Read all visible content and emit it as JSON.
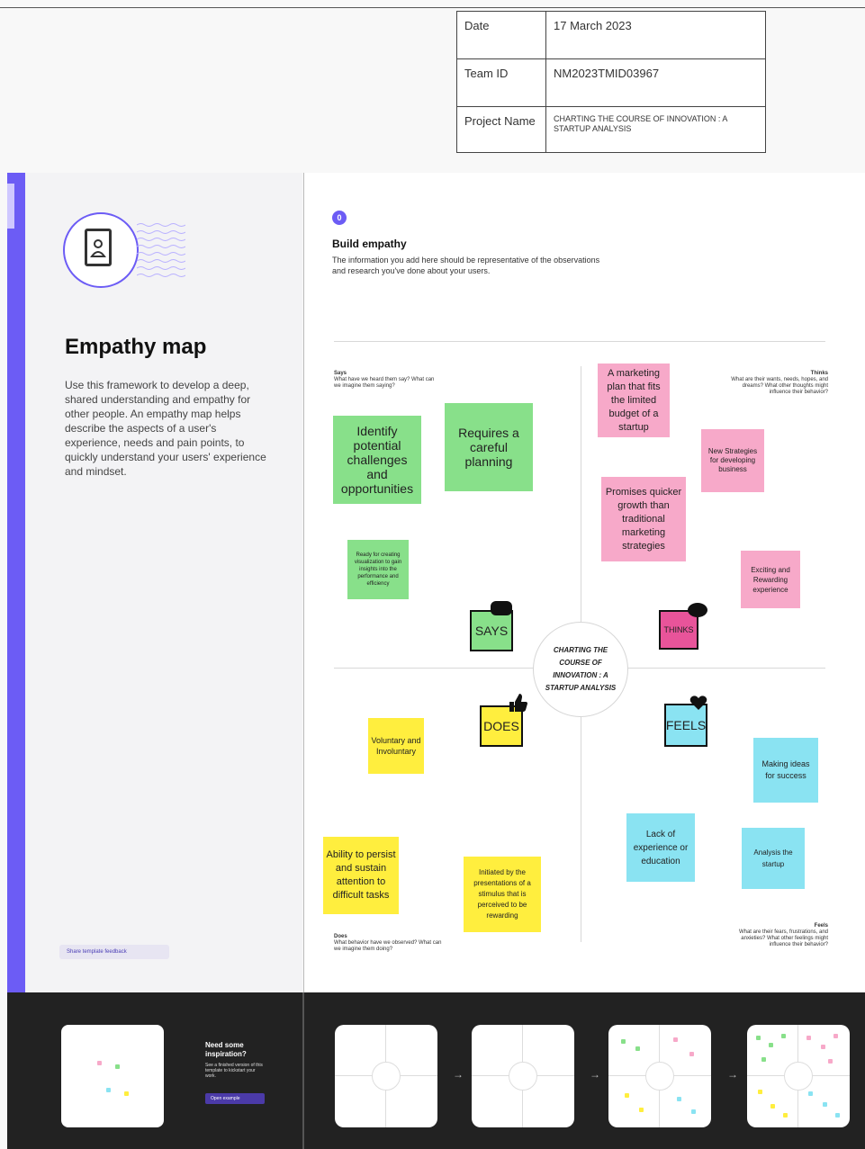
{
  "info_table": {
    "date_label": "Date",
    "date_value": "17 March 2023",
    "team_label": "Team ID",
    "team_value": "NM2023TMID03967",
    "project_label": "Project Name",
    "project_value": "CHARTING THE COURSE OF INNOVATION : A STARTUP ANALYSIS"
  },
  "left": {
    "title": "Empathy map",
    "description": "Use this framework to develop a deep, shared understanding and empathy for other people. An empathy map helps describe the aspects of a user's experience, needs and pain points, to quickly understand your users' experience and mindset.",
    "feedback_label": "Share template feedback"
  },
  "main": {
    "step": "0",
    "heading": "Build empathy",
    "description": "The information you add here should be representative of the observations and research you've done about your users.",
    "center_label": "CHARTING THE COURSE OF INNOVATION : A STARTUP ANALYSIS",
    "quadrants": {
      "says": {
        "title": "Says",
        "prompt": "What have we heard them say? What can we imagine them saying?",
        "tag": "SAYS"
      },
      "thinks": {
        "title": "Thinks",
        "prompt": "What are their wants, needs, hopes, and dreams? What other thoughts might influence their behavior?",
        "tag": "THINKS"
      },
      "does": {
        "title": "Does",
        "prompt": "What behavior have we observed? What can we imagine them doing?",
        "tag": "DOES"
      },
      "feels": {
        "title": "Feels",
        "prompt": "What are their fears, frustrations, and anxieties? What other feelings might influence their behavior?",
        "tag": "FEELS"
      }
    },
    "notes": {
      "n1": "Identify potential challenges and opportunities",
      "n2": "Requires a careful planning",
      "n3": "Ready for creating visualization to gain insights into the performance and efficiency",
      "n4": "A marketing plan that fits the limited budget of a startup",
      "n5": "New Strategies for developing business",
      "n6": "Promises quicker growth than traditional marketing strategies",
      "n7": "Exciting and Rewarding experience",
      "n8": "Voluntary and Involuntary",
      "n9": "Ability to persist and sustain attention to difficult tasks",
      "n10": "Initiated by the presentations of a stimulus that is perceived to be rewarding",
      "n11": "Making ideas for success",
      "n12": "Lack of experience or education",
      "n13": "Analysis the startup"
    }
  },
  "bottom": {
    "inspo_title": "Need some inspiration?",
    "inspo_text": "See a finished version of this template to kickstart your work.",
    "open_label": "Open example"
  },
  "colors": {
    "accent": "#6c5cf5",
    "green_note": "#88e08a",
    "pink_note": "#f7a9c9",
    "yellow_note": "#ffee3e",
    "blue_note": "#8ae3f2",
    "thinks_tag": "#e8549a"
  }
}
